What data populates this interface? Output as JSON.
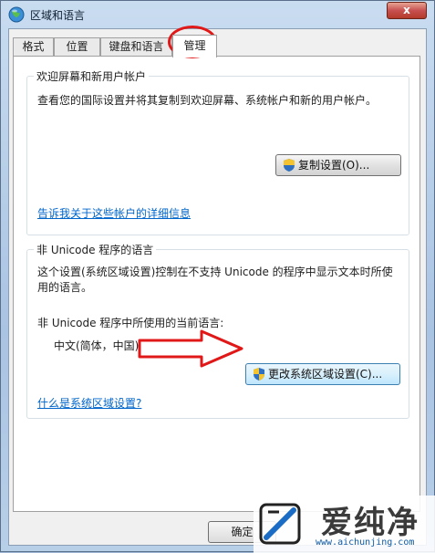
{
  "window": {
    "title": "区域和语言",
    "close_label": "x"
  },
  "tabs": [
    {
      "label": "格式"
    },
    {
      "label": "位置"
    },
    {
      "label": "键盘和语言"
    },
    {
      "label": "管理",
      "active": true
    }
  ],
  "welcome_group": {
    "title": "欢迎屏幕和新用户帐户",
    "description": "查看您的国际设置并将其复制到欢迎屏幕、系统帐户和新的用户帐户。",
    "copy_button": "复制设置(O)...",
    "link": "告诉我关于这些帐户的详细信息"
  },
  "unicode_group": {
    "title": "非 Unicode 程序的语言",
    "description_line1": "这个设置(系统区域设置)控制在不支持 Unicode 的程序中显示文本时所使",
    "description_line2": "用的语言。",
    "current_label": "非 Unicode 程序中所使用的当前语言:",
    "current_value": "中文(简体，中国)",
    "change_button": "更改系统区域设置(C)...",
    "link": "什么是系统区域设置?"
  },
  "footer": {
    "ok_button": "确定"
  },
  "watermark": {
    "title": "爱纯净",
    "url": "www.aichunjing.com"
  },
  "annotations": {
    "color": "#e01818"
  }
}
